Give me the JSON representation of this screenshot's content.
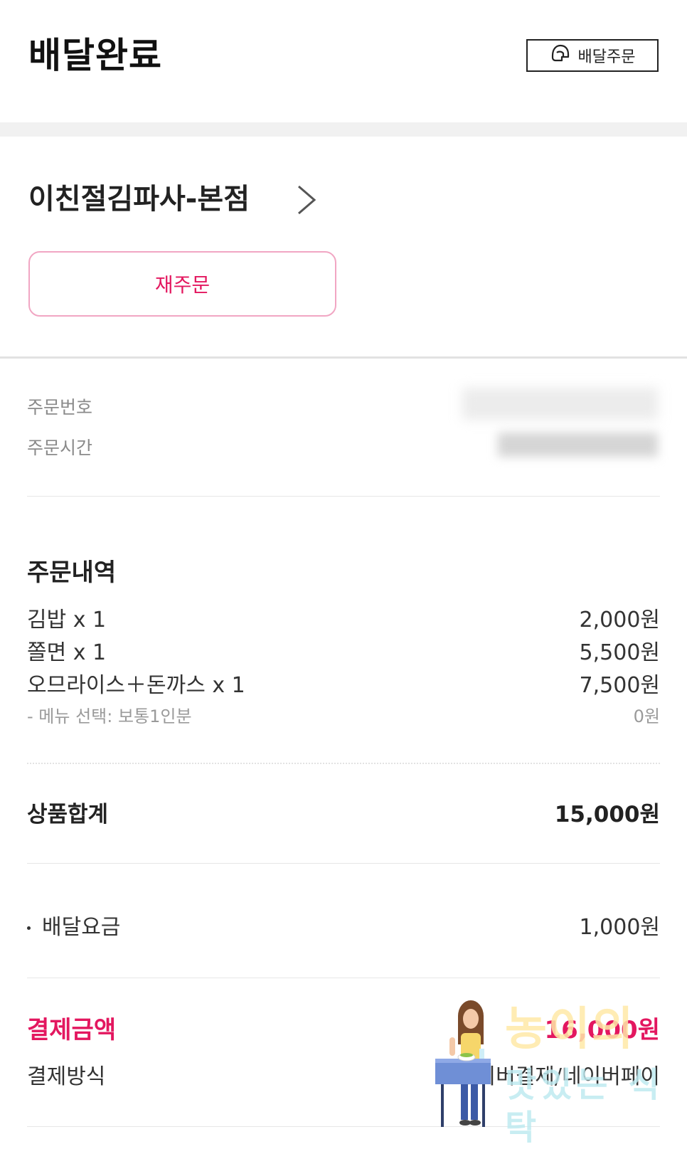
{
  "header": {
    "title": "배달완료",
    "delivery_order_label": "배달주문"
  },
  "store": {
    "name": "이친절김파사-본점",
    "reorder_label": "재주문"
  },
  "order_info": {
    "order_number_label": "주문번호",
    "order_time_label": "주문시간"
  },
  "order_details": {
    "heading": "주문내역",
    "items": [
      {
        "name": "김밥 x 1",
        "price": "2,000원"
      },
      {
        "name": "쫄면 x 1",
        "price": "5,500원"
      },
      {
        "name": "오므라이스＋돈까스 x 1",
        "price": "7,500원"
      }
    ],
    "option": {
      "name": "- 메뉴 선택: 보통1인분",
      "price": "0원"
    },
    "subtotal_label": "상품합계",
    "subtotal_value": "15,000원"
  },
  "fees": {
    "delivery_fee_label": "배달요금",
    "delivery_fee_value": "1,000원"
  },
  "payment": {
    "total_label": "결제금액",
    "total_value": "16,000원",
    "method_label": "결제방식",
    "method_value": "네이버결제/네이버페이"
  },
  "watermark": {
    "line1": "농이의",
    "line2": "맛있는 식탁"
  },
  "colors": {
    "accent": "#e3175f",
    "reorder_border": "#f1a6c3"
  }
}
